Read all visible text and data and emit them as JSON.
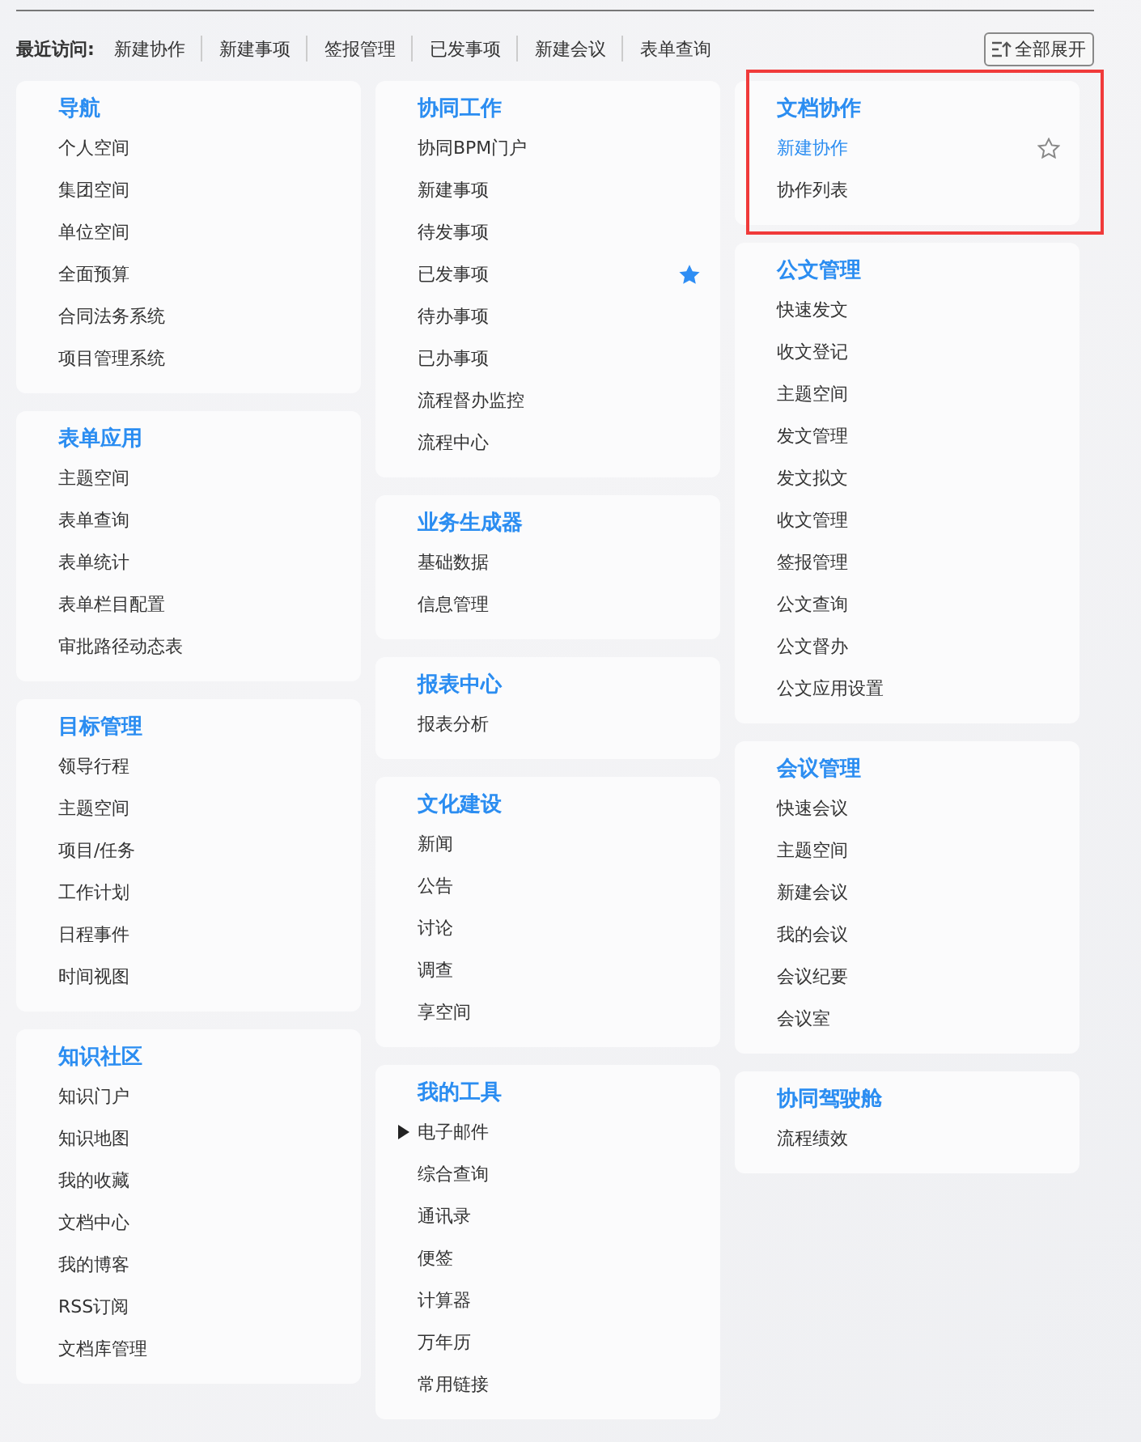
{
  "recent": {
    "label": "最近访问:",
    "links": [
      "新建协作",
      "新建事项",
      "签报管理",
      "已发事项",
      "新建会议",
      "表单查询"
    ]
  },
  "expand_button": {
    "label": "全部展开"
  },
  "columns": [
    [
      {
        "title": "导航",
        "highlighted": false,
        "items": [
          {
            "label": "个人空间",
            "kind": "plain"
          },
          {
            "label": "集团空间",
            "kind": "plain"
          },
          {
            "label": "单位空间",
            "kind": "plain"
          },
          {
            "label": "全面预算",
            "kind": "plain"
          },
          {
            "label": "合同法务系统",
            "kind": "plain"
          },
          {
            "label": "项目管理系统",
            "kind": "plain"
          }
        ]
      },
      {
        "title": "表单应用",
        "highlighted": false,
        "items": [
          {
            "label": "主题空间",
            "kind": "plain"
          },
          {
            "label": "表单查询",
            "kind": "plain"
          },
          {
            "label": "表单统计",
            "kind": "plain"
          },
          {
            "label": "表单栏目配置",
            "kind": "plain"
          },
          {
            "label": "审批路径动态表",
            "kind": "plain"
          }
        ]
      },
      {
        "title": "目标管理",
        "highlighted": false,
        "items": [
          {
            "label": "领导行程",
            "kind": "plain"
          },
          {
            "label": "主题空间",
            "kind": "plain"
          },
          {
            "label": "项目/任务",
            "kind": "plain"
          },
          {
            "label": "工作计划",
            "kind": "plain"
          },
          {
            "label": "日程事件",
            "kind": "plain"
          },
          {
            "label": "时间视图",
            "kind": "plain"
          }
        ]
      },
      {
        "title": "知识社区",
        "highlighted": false,
        "items": [
          {
            "label": "知识门户",
            "kind": "plain"
          },
          {
            "label": "知识地图",
            "kind": "plain"
          },
          {
            "label": "我的收藏",
            "kind": "plain"
          },
          {
            "label": "文档中心",
            "kind": "plain"
          },
          {
            "label": "我的博客",
            "kind": "plain"
          },
          {
            "label": "RSS订阅",
            "kind": "plain"
          },
          {
            "label": "文档库管理",
            "kind": "plain"
          }
        ]
      }
    ],
    [
      {
        "title": "协同工作",
        "highlighted": false,
        "items": [
          {
            "label": "协同BPM门户",
            "kind": "plain"
          },
          {
            "label": "新建事项",
            "kind": "plain"
          },
          {
            "label": "待发事项",
            "kind": "plain"
          },
          {
            "label": "已发事项",
            "kind": "starred"
          },
          {
            "label": "待办事项",
            "kind": "plain"
          },
          {
            "label": "已办事项",
            "kind": "plain"
          },
          {
            "label": "流程督办监控",
            "kind": "plain"
          },
          {
            "label": "流程中心",
            "kind": "plain"
          }
        ]
      },
      {
        "title": "业务生成器",
        "highlighted": false,
        "items": [
          {
            "label": "基础数据",
            "kind": "plain"
          },
          {
            "label": "信息管理",
            "kind": "plain"
          }
        ]
      },
      {
        "title": "报表中心",
        "highlighted": false,
        "items": [
          {
            "label": "报表分析",
            "kind": "plain"
          }
        ]
      },
      {
        "title": "文化建设",
        "highlighted": false,
        "items": [
          {
            "label": "新闻",
            "kind": "plain"
          },
          {
            "label": "公告",
            "kind": "plain"
          },
          {
            "label": "讨论",
            "kind": "plain"
          },
          {
            "label": "调查",
            "kind": "plain"
          },
          {
            "label": "享空间",
            "kind": "plain"
          }
        ]
      },
      {
        "title": "我的工具",
        "highlighted": false,
        "items": [
          {
            "label": "电子邮件",
            "kind": "pointer"
          },
          {
            "label": "综合查询",
            "kind": "plain"
          },
          {
            "label": "通讯录",
            "kind": "plain"
          },
          {
            "label": "便签",
            "kind": "plain"
          },
          {
            "label": "计算器",
            "kind": "plain"
          },
          {
            "label": "万年历",
            "kind": "plain"
          },
          {
            "label": "常用链接",
            "kind": "plain"
          }
        ]
      }
    ],
    [
      {
        "title": "文档协作",
        "highlighted": true,
        "items": [
          {
            "label": "新建协作",
            "kind": "hover"
          },
          {
            "label": "协作列表",
            "kind": "plain"
          }
        ]
      },
      {
        "title": "公文管理",
        "highlighted": false,
        "items": [
          {
            "label": "快速发文",
            "kind": "plain"
          },
          {
            "label": "收文登记",
            "kind": "plain"
          },
          {
            "label": "主题空间",
            "kind": "plain"
          },
          {
            "label": "发文管理",
            "kind": "plain"
          },
          {
            "label": "发文拟文",
            "kind": "plain"
          },
          {
            "label": "收文管理",
            "kind": "plain"
          },
          {
            "label": "签报管理",
            "kind": "plain"
          },
          {
            "label": "公文查询",
            "kind": "plain"
          },
          {
            "label": "公文督办",
            "kind": "plain"
          },
          {
            "label": "公文应用设置",
            "kind": "plain"
          }
        ]
      },
      {
        "title": "会议管理",
        "highlighted": false,
        "items": [
          {
            "label": "快速会议",
            "kind": "plain"
          },
          {
            "label": "主题空间",
            "kind": "plain"
          },
          {
            "label": "新建会议",
            "kind": "plain"
          },
          {
            "label": "我的会议",
            "kind": "plain"
          },
          {
            "label": "会议纪要",
            "kind": "plain"
          },
          {
            "label": "会议室",
            "kind": "plain"
          }
        ]
      },
      {
        "title": "协同驾驶舱",
        "highlighted": false,
        "items": [
          {
            "label": "流程绩效",
            "kind": "plain"
          }
        ]
      }
    ]
  ]
}
